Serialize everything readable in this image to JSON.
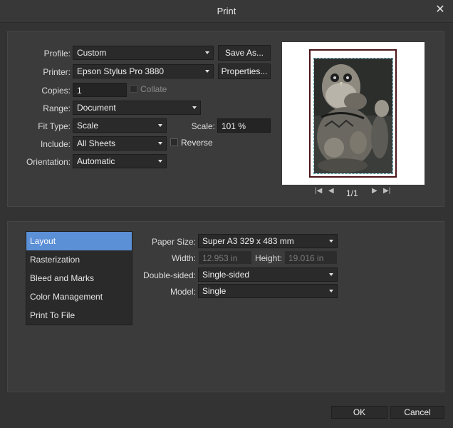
{
  "window": {
    "title": "Print"
  },
  "print": {
    "profile": {
      "label": "Profile:",
      "value": "Custom",
      "save_as": "Save As..."
    },
    "printer": {
      "label": "Printer:",
      "value": "Epson Stylus Pro 3880",
      "properties": "Properties..."
    },
    "copies": {
      "label": "Copies:",
      "value": "1",
      "collate": "Collate"
    },
    "range": {
      "label": "Range:",
      "value": "Document"
    },
    "fit_type": {
      "label": "Fit Type:",
      "value": "Scale"
    },
    "scale": {
      "label": "Scale:",
      "value": "101 %"
    },
    "include": {
      "label": "Include:",
      "value": "All Sheets",
      "reverse": "Reverse"
    },
    "orientation": {
      "label": "Orientation:",
      "value": "Automatic"
    }
  },
  "preview": {
    "page_indicator": "1/1"
  },
  "categories": [
    "Layout",
    "Rasterization",
    "Bleed and Marks",
    "Color Management",
    "Print To File"
  ],
  "layout": {
    "paper_size": {
      "label": "Paper Size:",
      "value": "Super A3 329 x 483 mm"
    },
    "width": {
      "label": "Width:",
      "value": "12.953 in"
    },
    "height": {
      "label": "Height:",
      "value": "19.016 in"
    },
    "double_sided": {
      "label": "Double-sided:",
      "value": "Single-sided"
    },
    "model": {
      "label": "Model:",
      "value": "Single"
    }
  },
  "footer": {
    "ok": "OK",
    "cancel": "Cancel"
  },
  "colors": {
    "accent": "#5b8fd6",
    "background": "#333333",
    "panel": "#3b3b3b"
  },
  "icons": [
    "close-icon",
    "first-page-icon",
    "prev-page-icon",
    "next-page-icon",
    "last-page-icon",
    "dropdown-arrow-icon"
  ]
}
